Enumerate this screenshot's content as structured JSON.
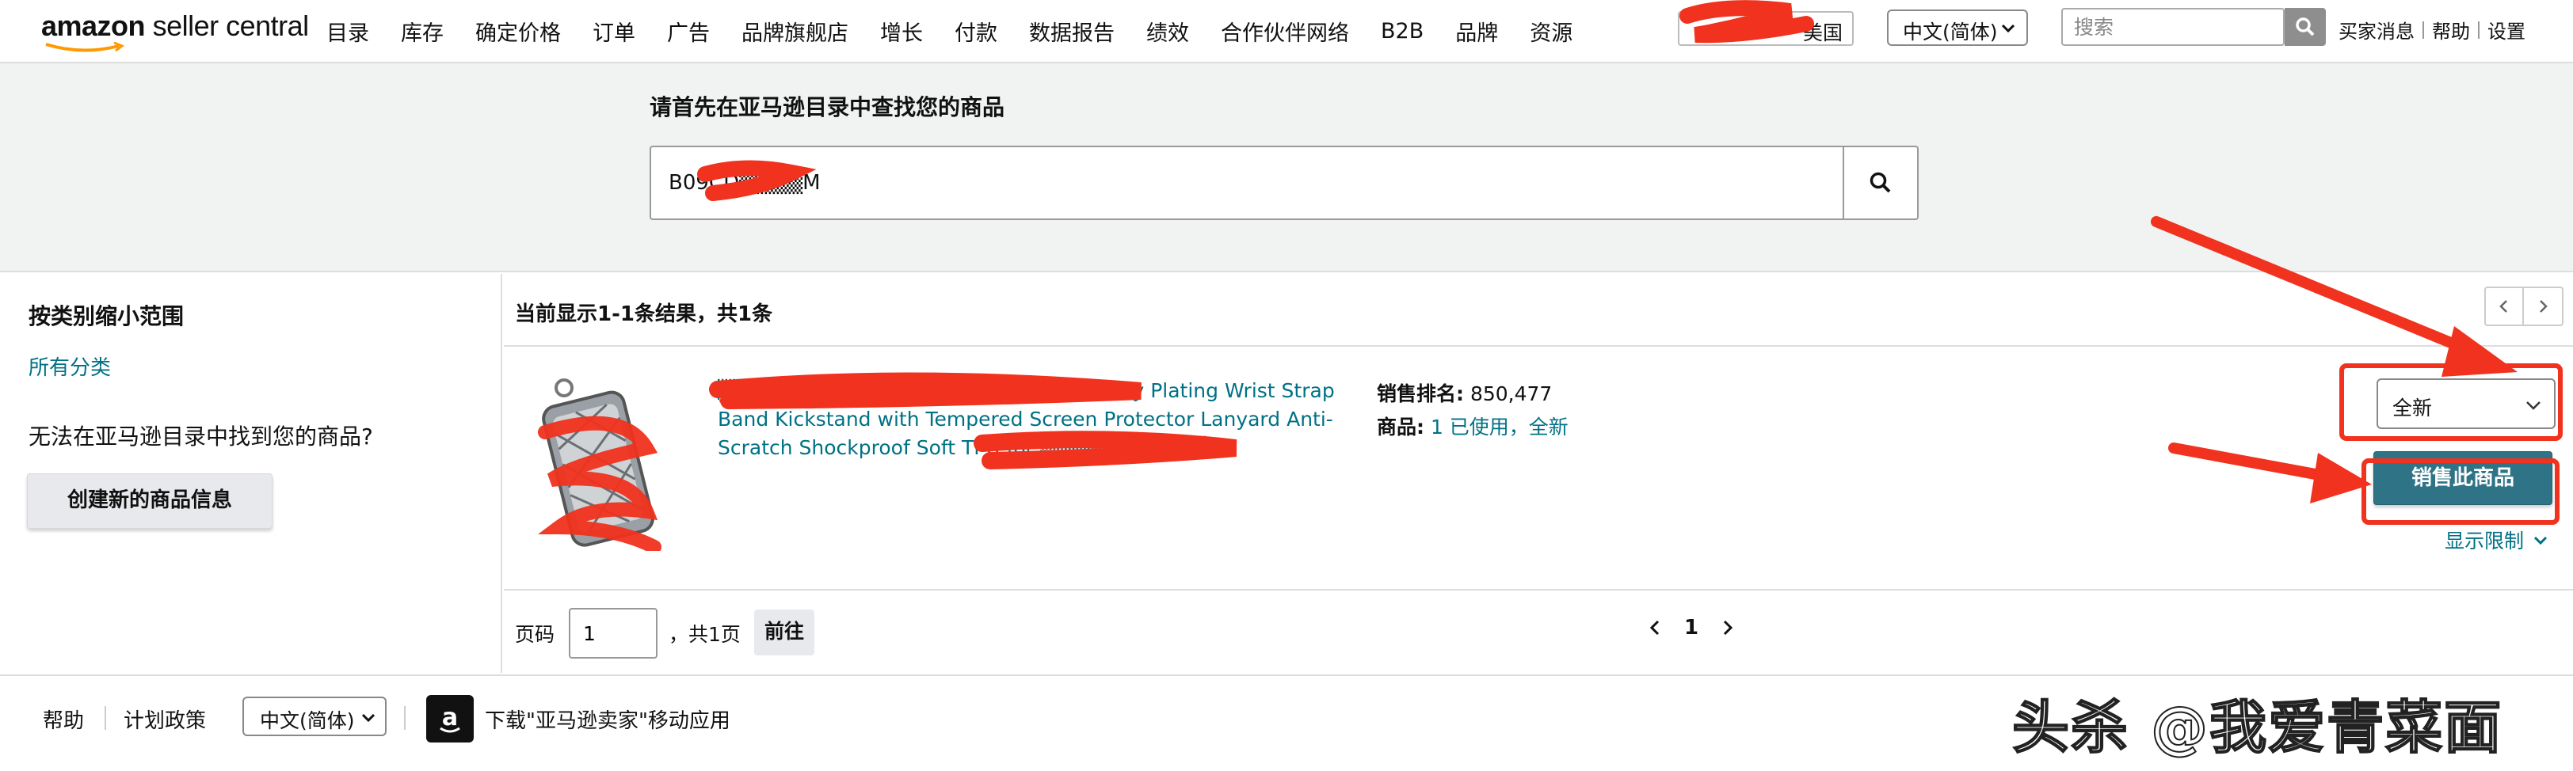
{
  "header": {
    "logo_brand": "amazon",
    "logo_product": "seller central",
    "nav": [
      "目录",
      "库存",
      "确定价格",
      "订单",
      "广告",
      "品牌旗舰店",
      "增长",
      "付款",
      "数据报告",
      "绩效",
      "合作伙伴网络",
      "B2B",
      "品牌",
      "资源"
    ],
    "marketplace": "美国",
    "language": "中文(简体)",
    "search_placeholder": "搜索",
    "links": [
      "买家消息",
      "帮助",
      "设置"
    ]
  },
  "search": {
    "title": "请首先在亚马逊目录中查找您的商品",
    "query": "B09CD▒▒▒▒M"
  },
  "filters": {
    "title": "按类别缩小范围",
    "all_categories": "所有分类",
    "not_found": "无法在亚马逊目录中找到您的商品?",
    "create_button": "创建新的商品信息"
  },
  "results": {
    "count_text": "当前显示1-1条结果，共1条",
    "items": [
      {
        "title": "▒▒▒▒▒▒▒▒▒▒▒▒▒▒▒▒▒▒▒▒ Inch Luxury Plating Wrist Strap Band Kickstand with Tempered Screen Protector Lanyard Anti-Scratch Shockproof Soft TPU for ▒▒▒▒▒▒▒▒▒▒▒)",
        "rank_label": "销售排名:",
        "rank_value": "850,477",
        "offers_label": "商品:",
        "offers_value": "1 已使用，全新",
        "condition": "全新",
        "sell_button": "销售此商品",
        "limits_link": "显示限制"
      }
    ],
    "page_label": "页码",
    "page_value": "1",
    "page_total": "，共1页",
    "go_button": "前往",
    "current_page": "1"
  },
  "footer": {
    "help": "帮助",
    "policies": "计划政策",
    "language": "中文(简体)",
    "app_text": "下载\"亚马逊卖家\"移动应用",
    "watermark": "头杀 @我爱青菜面"
  },
  "colors": {
    "link": "#007185",
    "sell_button": "#2e7386",
    "annotation": "#f0321e",
    "panel": "#f1f3f3"
  }
}
